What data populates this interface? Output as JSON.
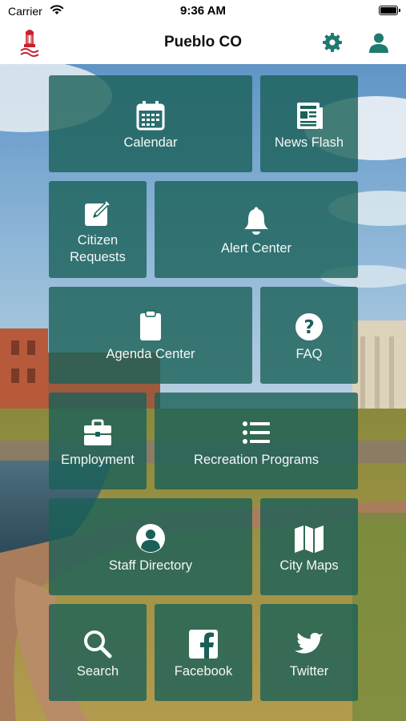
{
  "status_bar": {
    "carrier": "Carrier",
    "time": "9:36 AM"
  },
  "header": {
    "title": "Pueblo CO"
  },
  "colors": {
    "tile": "#1a6058",
    "accent": "#1f7a70",
    "logo": "#c8202f"
  },
  "tiles": [
    {
      "label": "Calendar",
      "icon": "calendar-icon"
    },
    {
      "label": "News Flash",
      "icon": "newspaper-icon"
    },
    {
      "label": "Citizen Requests",
      "icon": "edit-icon"
    },
    {
      "label": "Alert Center",
      "icon": "bell-icon"
    },
    {
      "label": "Agenda Center",
      "icon": "clipboard-icon"
    },
    {
      "label": "FAQ",
      "icon": "question-icon"
    },
    {
      "label": "Employment",
      "icon": "briefcase-icon"
    },
    {
      "label": "Recreation Programs",
      "icon": "list-icon"
    },
    {
      "label": "Staff Directory",
      "icon": "user-circle-icon"
    },
    {
      "label": "City Maps",
      "icon": "map-icon"
    },
    {
      "label": "Search",
      "icon": "search-icon"
    },
    {
      "label": "Facebook",
      "icon": "facebook-icon"
    },
    {
      "label": "Twitter",
      "icon": "twitter-icon"
    }
  ]
}
